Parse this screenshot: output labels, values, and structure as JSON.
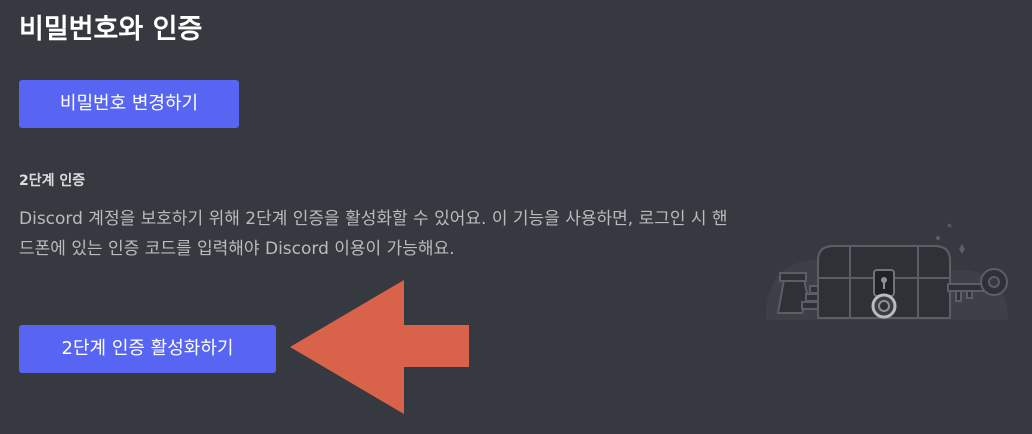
{
  "section": {
    "title": "비밀번호와 인증",
    "change_password_label": "비밀번호 변경하기"
  },
  "two_factor": {
    "heading": "2단계 인증",
    "description": "Discord 계정을 보호하기 위해 2단계 인증을 활성화할 수 있어요. 이 기능을 사용하면, 로그인 시 핸드폰에 있는 인증 코드를 입력해야 Discord 이용이 가능해요.",
    "enable_label": "2단계 인증 활성화하기"
  },
  "colors": {
    "background": "#36393f",
    "button": "#5865f2",
    "arrow": "#d9634a",
    "heading_text": "#ffffff",
    "body_text": "#b9bbbe"
  },
  "icons": {
    "arrow": "left-arrow-icon",
    "illustration": "treasure-chest-key-illustration"
  }
}
